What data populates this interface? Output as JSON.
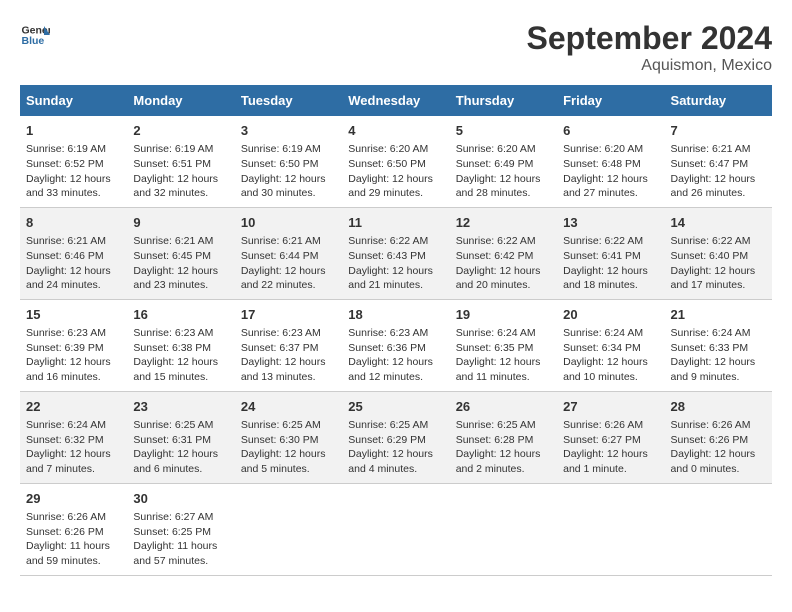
{
  "header": {
    "logo_line1": "General",
    "logo_line2": "Blue",
    "title": "September 2024",
    "subtitle": "Aquismon, Mexico"
  },
  "days_of_week": [
    "Sunday",
    "Monday",
    "Tuesday",
    "Wednesday",
    "Thursday",
    "Friday",
    "Saturday"
  ],
  "weeks": [
    {
      "group": 1,
      "cells": [
        {
          "day": "1",
          "sunrise": "Sunrise: 6:19 AM",
          "sunset": "Sunset: 6:52 PM",
          "daylight": "Daylight: 12 hours and 33 minutes."
        },
        {
          "day": "2",
          "sunrise": "Sunrise: 6:19 AM",
          "sunset": "Sunset: 6:51 PM",
          "daylight": "Daylight: 12 hours and 32 minutes."
        },
        {
          "day": "3",
          "sunrise": "Sunrise: 6:19 AM",
          "sunset": "Sunset: 6:50 PM",
          "daylight": "Daylight: 12 hours and 30 minutes."
        },
        {
          "day": "4",
          "sunrise": "Sunrise: 6:20 AM",
          "sunset": "Sunset: 6:50 PM",
          "daylight": "Daylight: 12 hours and 29 minutes."
        },
        {
          "day": "5",
          "sunrise": "Sunrise: 6:20 AM",
          "sunset": "Sunset: 6:49 PM",
          "daylight": "Daylight: 12 hours and 28 minutes."
        },
        {
          "day": "6",
          "sunrise": "Sunrise: 6:20 AM",
          "sunset": "Sunset: 6:48 PM",
          "daylight": "Daylight: 12 hours and 27 minutes."
        },
        {
          "day": "7",
          "sunrise": "Sunrise: 6:21 AM",
          "sunset": "Sunset: 6:47 PM",
          "daylight": "Daylight: 12 hours and 26 minutes."
        }
      ]
    },
    {
      "group": 2,
      "cells": [
        {
          "day": "8",
          "sunrise": "Sunrise: 6:21 AM",
          "sunset": "Sunset: 6:46 PM",
          "daylight": "Daylight: 12 hours and 24 minutes."
        },
        {
          "day": "9",
          "sunrise": "Sunrise: 6:21 AM",
          "sunset": "Sunset: 6:45 PM",
          "daylight": "Daylight: 12 hours and 23 minutes."
        },
        {
          "day": "10",
          "sunrise": "Sunrise: 6:21 AM",
          "sunset": "Sunset: 6:44 PM",
          "daylight": "Daylight: 12 hours and 22 minutes."
        },
        {
          "day": "11",
          "sunrise": "Sunrise: 6:22 AM",
          "sunset": "Sunset: 6:43 PM",
          "daylight": "Daylight: 12 hours and 21 minutes."
        },
        {
          "day": "12",
          "sunrise": "Sunrise: 6:22 AM",
          "sunset": "Sunset: 6:42 PM",
          "daylight": "Daylight: 12 hours and 20 minutes."
        },
        {
          "day": "13",
          "sunrise": "Sunrise: 6:22 AM",
          "sunset": "Sunset: 6:41 PM",
          "daylight": "Daylight: 12 hours and 18 minutes."
        },
        {
          "day": "14",
          "sunrise": "Sunrise: 6:22 AM",
          "sunset": "Sunset: 6:40 PM",
          "daylight": "Daylight: 12 hours and 17 minutes."
        }
      ]
    },
    {
      "group": 3,
      "cells": [
        {
          "day": "15",
          "sunrise": "Sunrise: 6:23 AM",
          "sunset": "Sunset: 6:39 PM",
          "daylight": "Daylight: 12 hours and 16 minutes."
        },
        {
          "day": "16",
          "sunrise": "Sunrise: 6:23 AM",
          "sunset": "Sunset: 6:38 PM",
          "daylight": "Daylight: 12 hours and 15 minutes."
        },
        {
          "day": "17",
          "sunrise": "Sunrise: 6:23 AM",
          "sunset": "Sunset: 6:37 PM",
          "daylight": "Daylight: 12 hours and 13 minutes."
        },
        {
          "day": "18",
          "sunrise": "Sunrise: 6:23 AM",
          "sunset": "Sunset: 6:36 PM",
          "daylight": "Daylight: 12 hours and 12 minutes."
        },
        {
          "day": "19",
          "sunrise": "Sunrise: 6:24 AM",
          "sunset": "Sunset: 6:35 PM",
          "daylight": "Daylight: 12 hours and 11 minutes."
        },
        {
          "day": "20",
          "sunrise": "Sunrise: 6:24 AM",
          "sunset": "Sunset: 6:34 PM",
          "daylight": "Daylight: 12 hours and 10 minutes."
        },
        {
          "day": "21",
          "sunrise": "Sunrise: 6:24 AM",
          "sunset": "Sunset: 6:33 PM",
          "daylight": "Daylight: 12 hours and 9 minutes."
        }
      ]
    },
    {
      "group": 4,
      "cells": [
        {
          "day": "22",
          "sunrise": "Sunrise: 6:24 AM",
          "sunset": "Sunset: 6:32 PM",
          "daylight": "Daylight: 12 hours and 7 minutes."
        },
        {
          "day": "23",
          "sunrise": "Sunrise: 6:25 AM",
          "sunset": "Sunset: 6:31 PM",
          "daylight": "Daylight: 12 hours and 6 minutes."
        },
        {
          "day": "24",
          "sunrise": "Sunrise: 6:25 AM",
          "sunset": "Sunset: 6:30 PM",
          "daylight": "Daylight: 12 hours and 5 minutes."
        },
        {
          "day": "25",
          "sunrise": "Sunrise: 6:25 AM",
          "sunset": "Sunset: 6:29 PM",
          "daylight": "Daylight: 12 hours and 4 minutes."
        },
        {
          "day": "26",
          "sunrise": "Sunrise: 6:25 AM",
          "sunset": "Sunset: 6:28 PM",
          "daylight": "Daylight: 12 hours and 2 minutes."
        },
        {
          "day": "27",
          "sunrise": "Sunrise: 6:26 AM",
          "sunset": "Sunset: 6:27 PM",
          "daylight": "Daylight: 12 hours and 1 minute."
        },
        {
          "day": "28",
          "sunrise": "Sunrise: 6:26 AM",
          "sunset": "Sunset: 6:26 PM",
          "daylight": "Daylight: 12 hours and 0 minutes."
        }
      ]
    },
    {
      "group": 5,
      "cells": [
        {
          "day": "29",
          "sunrise": "Sunrise: 6:26 AM",
          "sunset": "Sunset: 6:26 PM",
          "daylight": "Daylight: 11 hours and 59 minutes."
        },
        {
          "day": "30",
          "sunrise": "Sunrise: 6:27 AM",
          "sunset": "Sunset: 6:25 PM",
          "daylight": "Daylight: 11 hours and 57 minutes."
        },
        null,
        null,
        null,
        null,
        null
      ]
    }
  ]
}
